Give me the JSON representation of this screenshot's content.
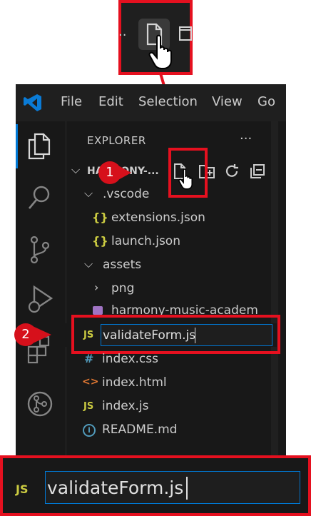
{
  "menu": [
    "File",
    "Edit",
    "Selection",
    "View",
    "Go"
  ],
  "sidebar": {
    "title": "EXPLORER",
    "more": "···",
    "project": "HARMONY-...",
    "tree": [
      {
        "label": ".vscode",
        "kind": "folder-open"
      },
      {
        "label": "extensions.json",
        "kind": "json"
      },
      {
        "label": "launch.json",
        "kind": "json"
      },
      {
        "label": "assets",
        "kind": "folder-open"
      },
      {
        "label": "png",
        "kind": "folder-closed"
      },
      {
        "label": "harmony-music-academ",
        "kind": "image"
      },
      {
        "label": "index.css",
        "kind": "css"
      },
      {
        "label": "index.html",
        "kind": "html"
      },
      {
        "label": "index.js",
        "kind": "js"
      },
      {
        "label": "README.md",
        "kind": "info"
      }
    ],
    "new_file": {
      "value": "validateForm.js",
      "icon": "JS"
    }
  },
  "callouts": {
    "step1": "1",
    "step2": "2"
  },
  "zoom": {
    "value": "validateForm.js",
    "icon": "JS"
  },
  "top_strip": {
    "left_dots": "..",
    "right_glyph": "new-folder-icon"
  },
  "colors": {
    "accent": "#0078d4",
    "highlight": "#e5101f",
    "js": "#cbcb41",
    "json": "#cbcb41",
    "html": "#e37933",
    "css": "#519aba"
  }
}
